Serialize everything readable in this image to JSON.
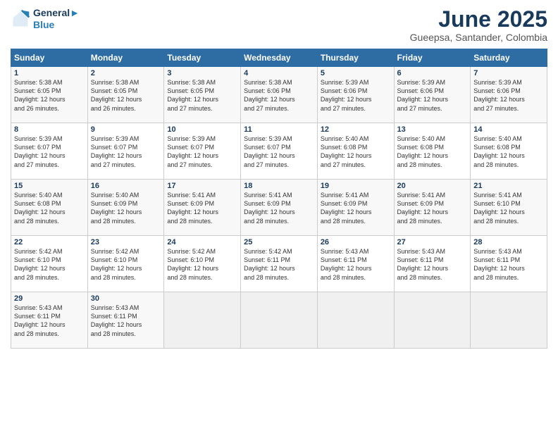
{
  "logo": {
    "line1": "General",
    "line2": "Blue"
  },
  "title": "June 2025",
  "subtitle": "Gueepsa, Santander, Colombia",
  "days_header": [
    "Sunday",
    "Monday",
    "Tuesday",
    "Wednesday",
    "Thursday",
    "Friday",
    "Saturday"
  ],
  "weeks": [
    [
      {
        "num": "1",
        "rise": "5:38 AM",
        "set": "6:05 PM",
        "hours": "12 hours",
        "mins": "and 26 minutes."
      },
      {
        "num": "2",
        "rise": "5:38 AM",
        "set": "6:05 PM",
        "hours": "12 hours",
        "mins": "and 26 minutes."
      },
      {
        "num": "3",
        "rise": "5:38 AM",
        "set": "6:05 PM",
        "hours": "12 hours",
        "mins": "and 27 minutes."
      },
      {
        "num": "4",
        "rise": "5:38 AM",
        "set": "6:06 PM",
        "hours": "12 hours",
        "mins": "and 27 minutes."
      },
      {
        "num": "5",
        "rise": "5:39 AM",
        "set": "6:06 PM",
        "hours": "12 hours",
        "mins": "and 27 minutes."
      },
      {
        "num": "6",
        "rise": "5:39 AM",
        "set": "6:06 PM",
        "hours": "12 hours",
        "mins": "and 27 minutes."
      },
      {
        "num": "7",
        "rise": "5:39 AM",
        "set": "6:06 PM",
        "hours": "12 hours",
        "mins": "and 27 minutes."
      }
    ],
    [
      {
        "num": "8",
        "rise": "5:39 AM",
        "set": "6:07 PM",
        "hours": "12 hours",
        "mins": "and 27 minutes."
      },
      {
        "num": "9",
        "rise": "5:39 AM",
        "set": "6:07 PM",
        "hours": "12 hours",
        "mins": "and 27 minutes."
      },
      {
        "num": "10",
        "rise": "5:39 AM",
        "set": "6:07 PM",
        "hours": "12 hours",
        "mins": "and 27 minutes."
      },
      {
        "num": "11",
        "rise": "5:39 AM",
        "set": "6:07 PM",
        "hours": "12 hours",
        "mins": "and 27 minutes."
      },
      {
        "num": "12",
        "rise": "5:40 AM",
        "set": "6:08 PM",
        "hours": "12 hours",
        "mins": "and 27 minutes."
      },
      {
        "num": "13",
        "rise": "5:40 AM",
        "set": "6:08 PM",
        "hours": "12 hours",
        "mins": "and 28 minutes."
      },
      {
        "num": "14",
        "rise": "5:40 AM",
        "set": "6:08 PM",
        "hours": "12 hours",
        "mins": "and 28 minutes."
      }
    ],
    [
      {
        "num": "15",
        "rise": "5:40 AM",
        "set": "6:08 PM",
        "hours": "12 hours",
        "mins": "and 28 minutes."
      },
      {
        "num": "16",
        "rise": "5:40 AM",
        "set": "6:09 PM",
        "hours": "12 hours",
        "mins": "and 28 minutes."
      },
      {
        "num": "17",
        "rise": "5:41 AM",
        "set": "6:09 PM",
        "hours": "12 hours",
        "mins": "and 28 minutes."
      },
      {
        "num": "18",
        "rise": "5:41 AM",
        "set": "6:09 PM",
        "hours": "12 hours",
        "mins": "and 28 minutes."
      },
      {
        "num": "19",
        "rise": "5:41 AM",
        "set": "6:09 PM",
        "hours": "12 hours",
        "mins": "and 28 minutes."
      },
      {
        "num": "20",
        "rise": "5:41 AM",
        "set": "6:09 PM",
        "hours": "12 hours",
        "mins": "and 28 minutes."
      },
      {
        "num": "21",
        "rise": "5:41 AM",
        "set": "6:10 PM",
        "hours": "12 hours",
        "mins": "and 28 minutes."
      }
    ],
    [
      {
        "num": "22",
        "rise": "5:42 AM",
        "set": "6:10 PM",
        "hours": "12 hours",
        "mins": "and 28 minutes."
      },
      {
        "num": "23",
        "rise": "5:42 AM",
        "set": "6:10 PM",
        "hours": "12 hours",
        "mins": "and 28 minutes."
      },
      {
        "num": "24",
        "rise": "5:42 AM",
        "set": "6:10 PM",
        "hours": "12 hours",
        "mins": "and 28 minutes."
      },
      {
        "num": "25",
        "rise": "5:42 AM",
        "set": "6:11 PM",
        "hours": "12 hours",
        "mins": "and 28 minutes."
      },
      {
        "num": "26",
        "rise": "5:43 AM",
        "set": "6:11 PM",
        "hours": "12 hours",
        "mins": "and 28 minutes."
      },
      {
        "num": "27",
        "rise": "5:43 AM",
        "set": "6:11 PM",
        "hours": "12 hours",
        "mins": "and 28 minutes."
      },
      {
        "num": "28",
        "rise": "5:43 AM",
        "set": "6:11 PM",
        "hours": "12 hours",
        "mins": "and 28 minutes."
      }
    ],
    [
      {
        "num": "29",
        "rise": "5:43 AM",
        "set": "6:11 PM",
        "hours": "12 hours",
        "mins": "and 28 minutes."
      },
      {
        "num": "30",
        "rise": "5:43 AM",
        "set": "6:11 PM",
        "hours": "12 hours",
        "mins": "and 28 minutes."
      },
      null,
      null,
      null,
      null,
      null
    ]
  ]
}
